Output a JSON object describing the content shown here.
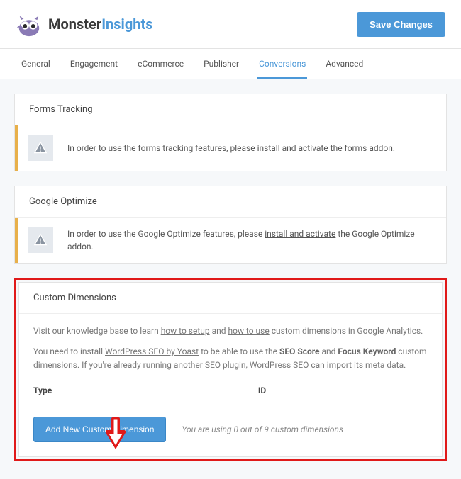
{
  "header": {
    "brand_part1": "Monster",
    "brand_part2": "Insights",
    "save_label": "Save Changes"
  },
  "tabs": [
    {
      "label": "General",
      "active": false
    },
    {
      "label": "Engagement",
      "active": false
    },
    {
      "label": "eCommerce",
      "active": false
    },
    {
      "label": "Publisher",
      "active": false
    },
    {
      "label": "Conversions",
      "active": true
    },
    {
      "label": "Advanced",
      "active": false
    }
  ],
  "forms_panel": {
    "title": "Forms Tracking",
    "notice_pre": "In order to use the forms tracking features, please ",
    "notice_link": "install and activate",
    "notice_post": " the forms addon."
  },
  "optimize_panel": {
    "title": "Google Optimize",
    "notice_pre": "In order to use the Google Optimize features, please ",
    "notice_link": "install and activate",
    "notice_post": " the Google Optimize addon."
  },
  "custom_dimensions": {
    "title": "Custom Dimensions",
    "kb_pre": "Visit our knowledge base to learn ",
    "kb_link1": "how to setup",
    "kb_mid": " and ",
    "kb_link2": "how to use",
    "kb_post": " custom dimensions in Google Analytics.",
    "seo_pre": "You need to install ",
    "seo_link": "WordPress SEO by Yoast",
    "seo_mid": " to be able to use the ",
    "seo_b1": "SEO Score",
    "seo_and": " and ",
    "seo_b2": "Focus Keyword",
    "seo_post": " custom dimensions. If you're already running another SEO plugin, WordPress SEO can import its meta data.",
    "col_type": "Type",
    "col_id": "ID",
    "add_button": "Add New Custom Dimension",
    "usage_text": "You are using 0 out of 9 custom dimensions"
  }
}
